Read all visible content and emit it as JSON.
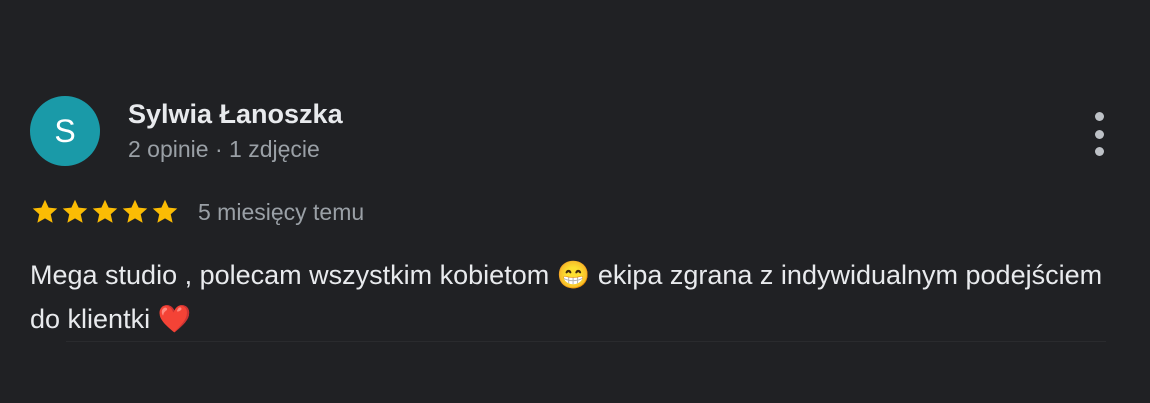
{
  "review": {
    "avatar_letter": "S",
    "author_name": "Sylwia Łanoszka",
    "author_meta": "2 opinie · 1 zdjęcie",
    "rating": 5,
    "max_rating": 5,
    "time_ago": "5 miesięcy temu",
    "text_part1": "Mega studio , polecam wszystkim kobietom ",
    "emoji1": "😁",
    "text_part2": " ekipa zgrana z indywidualnym podejściem do klientki ",
    "emoji2": "❤️"
  },
  "colors": {
    "background": "#202124",
    "avatar": "#1a9aa8",
    "star": "#fbbc04",
    "primary_text": "#e8eaed",
    "secondary_text": "#9aa0a6"
  },
  "icons": {
    "more": "more-vert-icon",
    "star": "star-icon"
  }
}
